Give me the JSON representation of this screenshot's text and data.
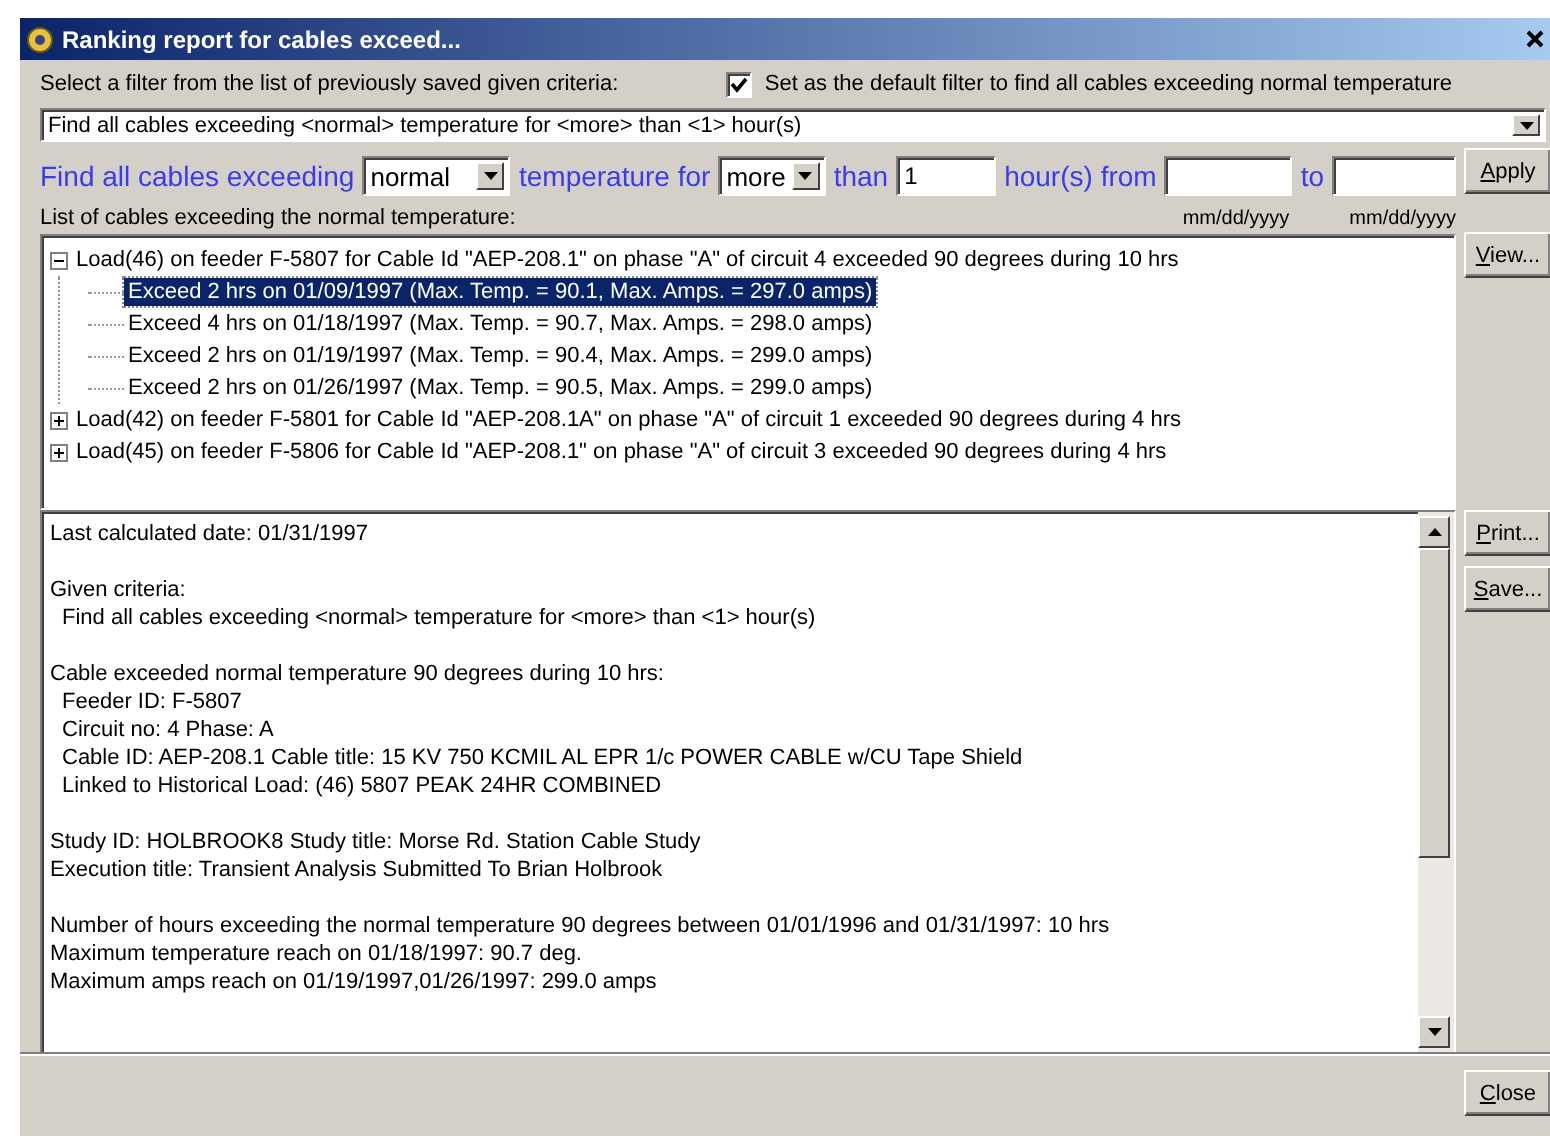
{
  "window": {
    "title": "Ranking report for cables exceed..."
  },
  "filter": {
    "label": "Select a filter from the list of previously saved given criteria:",
    "default_checkbox": {
      "label": "Set as the default filter to find all cables exceeding normal temperature",
      "checked": true
    },
    "selected": "Find all cables exceeding <normal> temperature for <more> than <1> hour(s)"
  },
  "criteria": {
    "text_1": "Find all cables exceeding",
    "level_value": "normal",
    "text_2": "temperature for",
    "comparison_value": "more",
    "text_3": "than",
    "hours_value": "1",
    "text_4": "hour(s) from",
    "text_5": "to",
    "from_hint": "mm/dd/yyyy",
    "to_hint": "mm/dd/yyyy"
  },
  "apply_button": "Apply",
  "list_label": "List of cables exceeding the normal temperature:",
  "tree": [
    {
      "label": "Load(46) on feeder F-5807 for Cable Id \"AEP-208.1\" on phase \"A\" of circuit 4 exceeded 90 degrees during 10 hrs",
      "expanded": true,
      "selected": false,
      "children": [
        {
          "label": "Exceed 2 hrs on 01/09/1997 (Max. Temp. = 90.1, Max. Amps. = 297.0 amps)",
          "selected": true
        },
        {
          "label": "Exceed 4 hrs on 01/18/1997 (Max. Temp. = 90.7, Max. Amps. = 298.0 amps)",
          "selected": false
        },
        {
          "label": "Exceed 2 hrs on 01/19/1997 (Max. Temp. = 90.4, Max. Amps. = 299.0 amps)",
          "selected": false
        },
        {
          "label": "Exceed 2 hrs on 01/26/1997 (Max. Temp. = 90.5, Max. Amps. = 299.0 amps)",
          "selected": false
        }
      ]
    },
    {
      "label": "Load(42) on feeder F-5801 for Cable Id \"AEP-208.1A\" on phase \"A\" of circuit 1 exceeded 90 degrees during 4 hrs",
      "expanded": false,
      "selected": false
    },
    {
      "label": "Load(45) on feeder F-5806 for Cable Id \"AEP-208.1\" on phase \"A\" of circuit 3 exceeded 90 degrees during 4 hrs",
      "expanded": false,
      "selected": false
    }
  ],
  "details": [
    {
      "kind": "section",
      "lines": [
        {
          "text": "Last calculated date: 01/31/1997",
          "indent": false
        }
      ]
    },
    {
      "kind": "section",
      "lines": [
        {
          "text": "Given criteria:",
          "indent": false
        },
        {
          "text": "Find all cables exceeding <normal> temperature for <more> than <1> hour(s)",
          "indent": true
        }
      ]
    },
    {
      "kind": "section",
      "lines": [
        {
          "text": "Cable exceeded normal temperature 90 degrees during 10 hrs:",
          "indent": false
        },
        {
          "text": "Feeder ID: F-5807",
          "indent": true
        },
        {
          "text": "Circuit no: 4  Phase: A",
          "indent": true
        },
        {
          "text": "Cable ID: AEP-208.1   Cable title: 15 KV 750 KCMIL AL EPR 1/c POWER CABLE w/CU Tape Shield",
          "indent": true
        },
        {
          "text": "Linked to Historical Load: (46) 5807 PEAK 24HR COMBINED",
          "indent": true
        }
      ]
    },
    {
      "kind": "section",
      "lines": [
        {
          "text": "Study ID: HOLBROOK8   Study title: Morse Rd. Station Cable Study",
          "indent": false
        },
        {
          "text": "Execution title: Transient Analysis Submitted To Brian Holbrook",
          "indent": false
        }
      ]
    },
    {
      "kind": "summary",
      "lines": [
        {
          "text": "Number of hours exceeding the normal temperature 90 degrees between 01/01/1996 and 01/31/1997: 10 hrs",
          "indent": false
        },
        {
          "text": "Maximum temperature reach on 01/18/1997: 90.7 deg.",
          "indent": false
        },
        {
          "text": "Maximum amps reach on 01/19/1997,01/26/1997: 299.0 amps",
          "indent": false
        }
      ]
    }
  ],
  "tree_buttons": [
    {
      "label": "View..."
    }
  ],
  "details_buttons": [
    {
      "label": "Print..."
    },
    {
      "label": "Save..."
    }
  ],
  "close_button": "Close"
}
